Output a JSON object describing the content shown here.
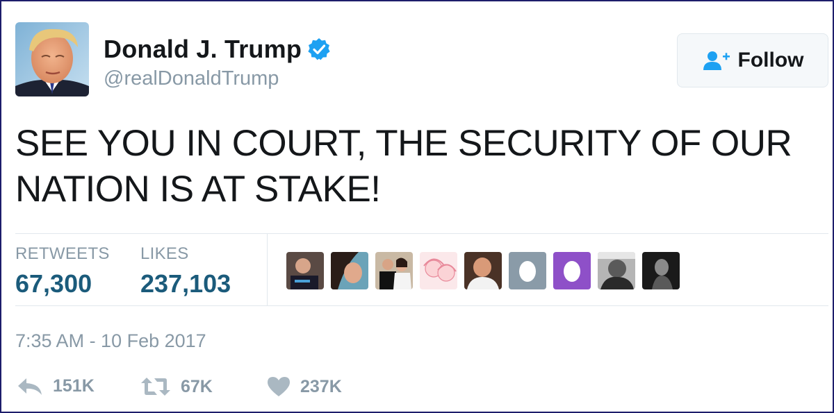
{
  "author": {
    "name": "Donald J. Trump",
    "handle": "@realDonaldTrump",
    "verified": true
  },
  "follow_button": {
    "label": "Follow",
    "icon": "follow-user-icon"
  },
  "tweet": {
    "line1": "SEE YOU IN COURT, THE SECURITY OF OUR",
    "line2": "NATION IS AT STAKE!"
  },
  "stats": {
    "retweets_label": "RETWEETS",
    "retweets_value": "67,300",
    "likes_label": "LIKES",
    "likes_value": "237,103"
  },
  "likers": [
    "photo",
    "photo",
    "photo",
    "illustration",
    "photo",
    "egg-default",
    "egg-default-purple",
    "photo",
    "photo"
  ],
  "timestamp": "7:35 AM - 10 Feb 2017",
  "actions": {
    "reply_count": "151K",
    "retweet_count": "67K",
    "like_count": "237K"
  },
  "colors": {
    "verified_blue": "#1da1f2",
    "stat_value": "#1b5b7b",
    "muted": "#8899a6",
    "text": "#14171a",
    "frame_border": "#1d1d6b"
  }
}
